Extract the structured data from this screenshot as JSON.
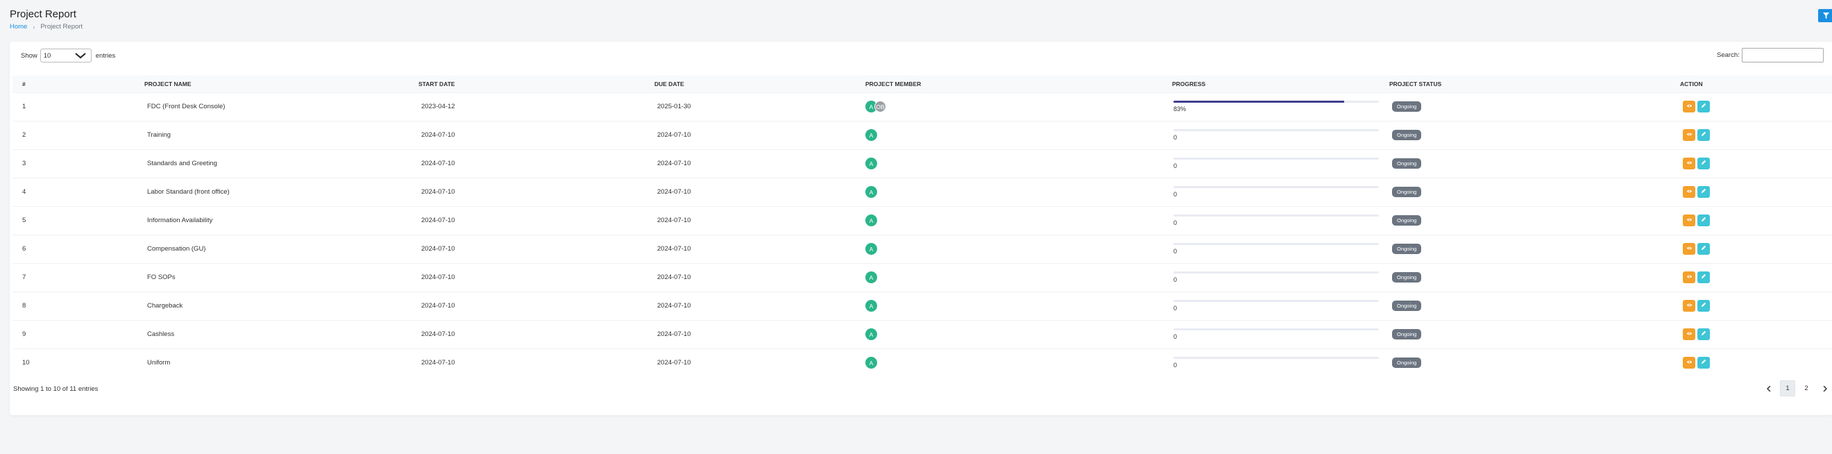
{
  "header": {
    "title": "Project Report",
    "breadcrumb": [
      "Home",
      "Project Report"
    ]
  },
  "toolbar": {
    "filter_icon": "filter-icon"
  },
  "controls": {
    "show_label": "Show",
    "page_length": "10",
    "entries_label": "entries",
    "search_label": "Search:",
    "search_value": ""
  },
  "table": {
    "columns": [
      "#",
      "PROJECT NAME",
      "START DATE",
      "DUE DATE",
      "PROJECT MEMBER",
      "PROGRESS",
      "PROJECT STATUS",
      "ACTION"
    ],
    "rows": [
      {
        "num": "1",
        "name": "FDC (Front Desk Console)",
        "start": "2023-04-12",
        "due": "2025-01-30",
        "members": [
          "A",
          "OB"
        ],
        "progress": 83,
        "progress_label": "83%",
        "status": "Ongoing"
      },
      {
        "num": "2",
        "name": "Training",
        "start": "2024-07-10",
        "due": "2024-07-10",
        "members": [
          "A"
        ],
        "progress": 0,
        "progress_label": "0",
        "status": "Ongoing"
      },
      {
        "num": "3",
        "name": "Standards and Greeting",
        "start": "2024-07-10",
        "due": "2024-07-10",
        "members": [
          "A"
        ],
        "progress": 0,
        "progress_label": "0",
        "status": "Ongoing"
      },
      {
        "num": "4",
        "name": "Labor Standard (front office)",
        "start": "2024-07-10",
        "due": "2024-07-10",
        "members": [
          "A"
        ],
        "progress": 0,
        "progress_label": "0",
        "status": "Ongoing"
      },
      {
        "num": "5",
        "name": "Information Availability",
        "start": "2024-07-10",
        "due": "2024-07-10",
        "members": [
          "A"
        ],
        "progress": 0,
        "progress_label": "0",
        "status": "Ongoing"
      },
      {
        "num": "6",
        "name": "Compensation (GU)",
        "start": "2024-07-10",
        "due": "2024-07-10",
        "members": [
          "A"
        ],
        "progress": 0,
        "progress_label": "0",
        "status": "Ongoing"
      },
      {
        "num": "7",
        "name": "FO SOPs",
        "start": "2024-07-10",
        "due": "2024-07-10",
        "members": [
          "A"
        ],
        "progress": 0,
        "progress_label": "0",
        "status": "Ongoing"
      },
      {
        "num": "8",
        "name": "Chargeback",
        "start": "2024-07-10",
        "due": "2024-07-10",
        "members": [
          "A"
        ],
        "progress": 0,
        "progress_label": "0",
        "status": "Ongoing"
      },
      {
        "num": "9",
        "name": "Cashless",
        "start": "2024-07-10",
        "due": "2024-07-10",
        "members": [
          "A"
        ],
        "progress": 0,
        "progress_label": "0",
        "status": "Ongoing"
      },
      {
        "num": "10",
        "name": "Uniform",
        "start": "2024-07-10",
        "due": "2024-07-10",
        "members": [
          "A"
        ],
        "progress": 0,
        "progress_label": "0",
        "status": "Ongoing"
      }
    ],
    "actions": [
      {
        "icon": "eye-icon",
        "color": "#f4a02b"
      },
      {
        "icon": "pencil-icon",
        "color": "#3ec5d6"
      }
    ]
  },
  "footer": {
    "info": "Showing 1 to 10 of 11 entries",
    "pages": [
      "1",
      "2"
    ],
    "active_page": "1"
  },
  "colors": {
    "accent": "#1a8fe3",
    "progress": "#3f3f8f",
    "avatar_a": "#2bb58a",
    "avatar_ob": "#9aa0a6",
    "status_badge": "#6b7480"
  }
}
